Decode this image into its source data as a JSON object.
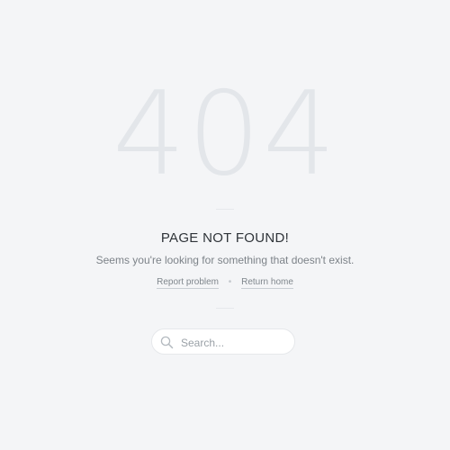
{
  "error_code": "404",
  "title": "PAGE NOT FOUND!",
  "subtitle": "Seems you're looking for something that doesn't exist.",
  "links": {
    "report_problem": "Report problem",
    "separator": "•",
    "return_home": "Return home"
  },
  "search": {
    "placeholder": "Search...",
    "icon": "search-icon"
  },
  "colors": {
    "background": "#f4f5f7",
    "big_code": "#e3e6ea",
    "title": "#2f3439",
    "text_muted": "#7d8389"
  }
}
